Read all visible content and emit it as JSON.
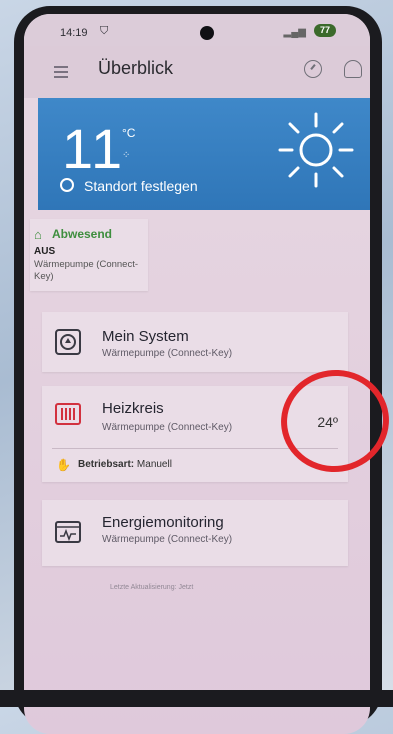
{
  "status_bar": {
    "time": "14:19",
    "battery": "77"
  },
  "header": {
    "title": "Überblick"
  },
  "weather": {
    "temperature": "11",
    "unit": "°C",
    "location_link": "Standort festlegen"
  },
  "away_card": {
    "status": "Abwesend",
    "mode": "AUS",
    "device": "Wärmepumpe (Connect-Key)"
  },
  "cards": {
    "system": {
      "title": "Mein System",
      "subtitle": "Wärmepumpe (Connect-Key)"
    },
    "heating": {
      "title": "Heizkreis",
      "subtitle": "Wärmepumpe (Connect-Key)",
      "setpoint": "24º",
      "mode_label": "Betriebsart:",
      "mode_value": "Manuell"
    },
    "energy": {
      "title": "Energiemonitoring",
      "subtitle": "Wärmepumpe (Connect-Key)"
    }
  },
  "footer": {
    "last_update": "Letzte Aktualisierung: Jetzt"
  },
  "colors": {
    "accent": "#2f76b8",
    "annotation": "#e2262b",
    "away_green": "#3e8e3e",
    "heating_red": "#d2313f"
  }
}
